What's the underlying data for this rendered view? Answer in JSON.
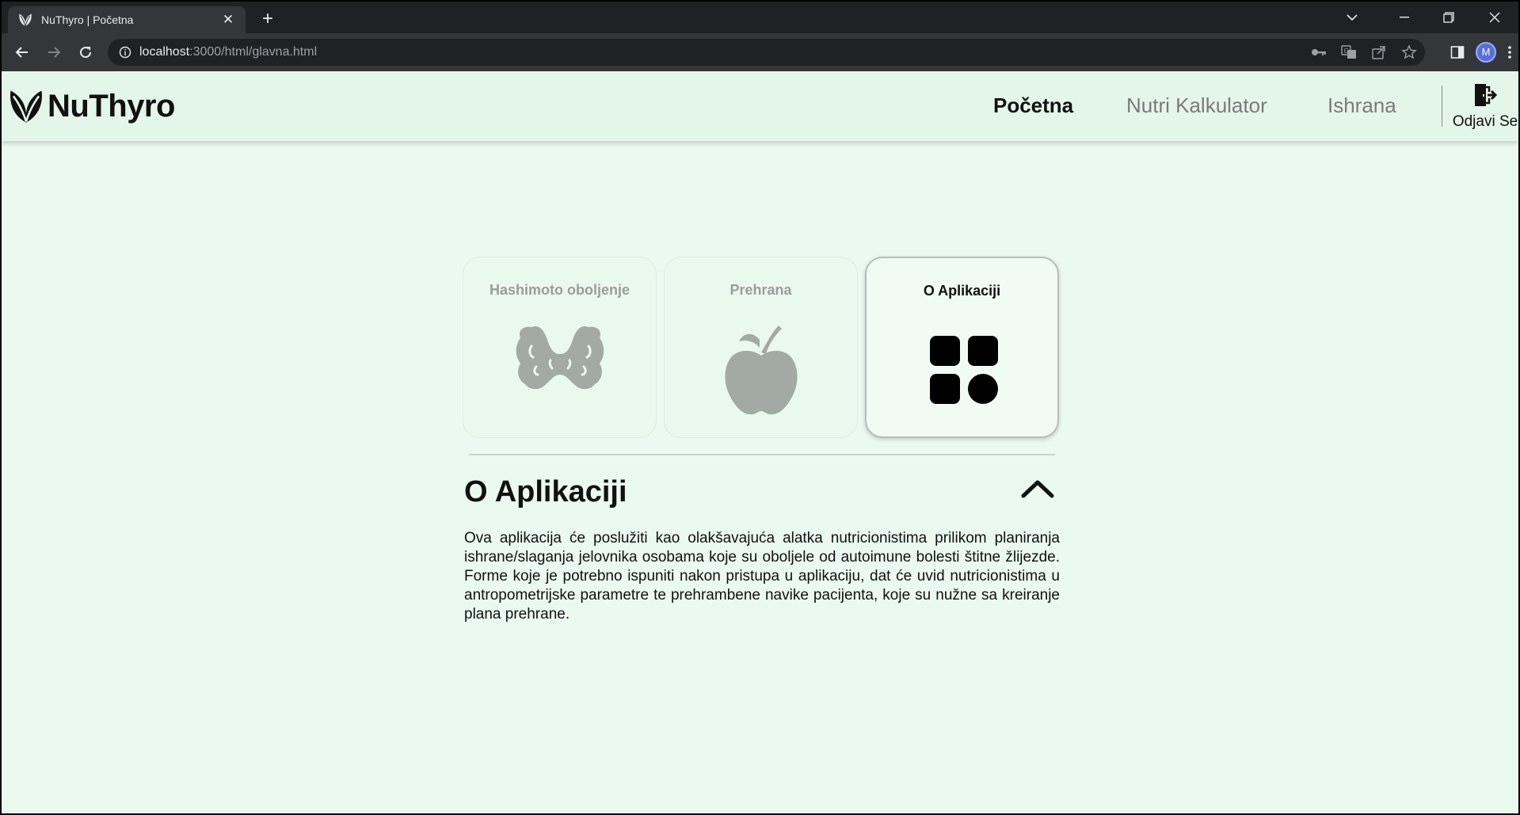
{
  "browser": {
    "tab_title": "NuThyro | Početna",
    "tab_close": "✕",
    "new_tab": "+",
    "url_host": "localhost",
    "url_path": ":3000/html/glavna.html",
    "profile_initial": "M"
  },
  "site": {
    "brand": "NuThyro",
    "nav": [
      {
        "label": "Početna",
        "active": true
      },
      {
        "label": "Nutri Kalkulator",
        "active": false
      },
      {
        "label": "Ishrana",
        "active": false
      }
    ],
    "logout_label": "Odjavi Se"
  },
  "cards": [
    {
      "title": "Hashimoto oboljenje",
      "icon": "thyroid-icon",
      "active": false
    },
    {
      "title": "Prehrana",
      "icon": "apple-icon",
      "active": false
    },
    {
      "title": "O Aplikaciji",
      "icon": "apps-grid-icon",
      "active": true
    }
  ],
  "section": {
    "title": "O Aplikaciji",
    "text": "Ova aplikacija će poslužiti kao olakšavajuća alatka nutricionistima prilikom planiranja ishrane/slaganja jelovnika osobama koje su oboljele od autoimune bolesti štitne žlijezde. Forme koje je potrebno ispuniti nakon pristupa u aplikaciju, dat će uvid nutricionistima u antropometrijske parametre te prehrambene navike pacijenta, koje su nužne sa kreiranje plana prehrane."
  },
  "colors": {
    "accent_bg": "#eafaf0",
    "header_bg": "#e4f6e9",
    "inactive_icon": "#a3aaa3",
    "active_icon": "#000000"
  }
}
